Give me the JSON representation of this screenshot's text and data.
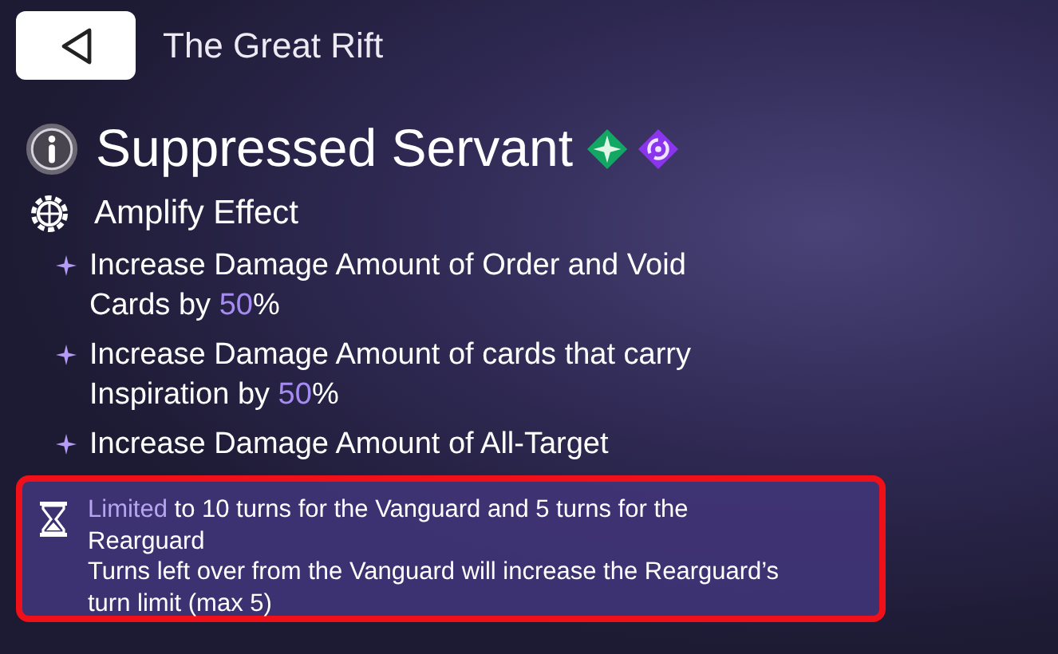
{
  "header": {
    "title": "The Great Rift"
  },
  "effect": {
    "name": "Suppressed Servant"
  },
  "section": {
    "title": "Amplify Effect"
  },
  "bullets": [
    [
      {
        "text": "Increase Damage Amount of Order and Void Cards by ",
        "kind": "plain"
      },
      {
        "text": "50",
        "kind": "highlight"
      },
      {
        "text": "%",
        "kind": "plain"
      }
    ],
    [
      {
        "text": "Increase Damage Amount of cards that carry Inspiration by ",
        "kind": "plain"
      },
      {
        "text": "50",
        "kind": "highlight"
      },
      {
        "text": "%",
        "kind": "plain"
      }
    ],
    [
      {
        "text": "Increase Damage Amount of All-Target",
        "kind": "plain"
      }
    ]
  ],
  "notice": {
    "lines": [
      [
        {
          "text": "Limited",
          "kind": "highlight"
        },
        {
          "text": " to 10 turns for the Vanguard and 5 turns for the Rearguard",
          "kind": "plain"
        }
      ],
      [
        {
          "text": "Turns left over from the Vanguard will increase the Rearguard’s turn limit (max 5)",
          "kind": "plain"
        }
      ]
    ]
  }
}
